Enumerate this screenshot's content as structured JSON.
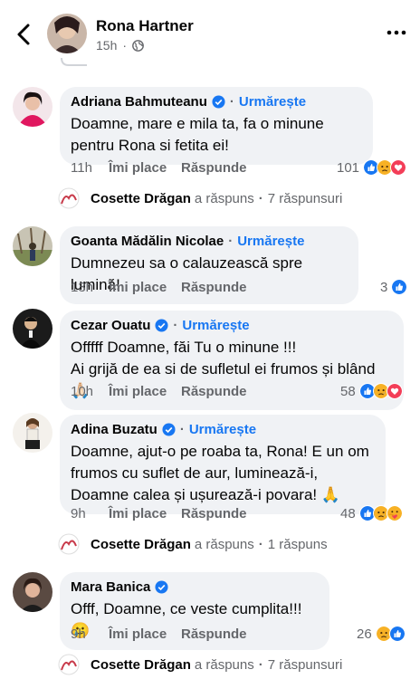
{
  "header": {
    "name": "Rona Hartner",
    "time": "15h",
    "globe_icon": "globe-icon"
  },
  "comments": [
    {
      "author": "Adriana Bahmuteanu",
      "verified": true,
      "follow": "Urmărește",
      "text": "Doamne, mare e mila ta, fa o minune pentru Rona si fetita ei!",
      "time": "11h",
      "like": "Îmi place",
      "reply": "Răspunde",
      "reaction_count": "101",
      "reactions": [
        "like",
        "sad",
        "love"
      ],
      "reply_summary": {
        "name": "Cosette Drăgan",
        "action": "a răspuns",
        "count": "7 răspunsuri"
      }
    },
    {
      "author": "Goanta Mădălin Nicolae",
      "verified": false,
      "follow": "Urmărește",
      "text": "Dumnezeu sa o calauzească spre lumină!",
      "time": "13h",
      "like": "Îmi place",
      "reply": "Răspunde",
      "reaction_count": "3",
      "reactions": [
        "like"
      ]
    },
    {
      "author": "Cezar Ouatu",
      "verified": true,
      "follow": "Urmărește",
      "text": "Offfff Doamne, făi Tu o minune !!!\nAi grijă de ea si de sufletul ei frumos și blând 🙏🏻",
      "time": "10h",
      "like": "Îmi place",
      "reply": "Răspunde",
      "reaction_count": "58",
      "reactions": [
        "like",
        "sad",
        "love"
      ]
    },
    {
      "author": "Adina Buzatu",
      "verified": true,
      "follow": "Urmărește",
      "text": "Doamne, ajut-o pe roaba ta, Rona! E un om frumos cu suflet de aur, luminează-i, Doamne calea și ușurează-i povara! 🙏",
      "time": "9h",
      "like": "Îmi place",
      "reply": "Răspunde",
      "reaction_count": "48",
      "reactions": [
        "like",
        "sad",
        "care"
      ],
      "reply_summary": {
        "name": "Cosette Drăgan",
        "action": "a răspuns",
        "count": "1 răspuns"
      }
    },
    {
      "author": "Mara Banica",
      "verified": true,
      "follow": "",
      "text": "Offf, Doamne, ce veste cumplita!!!🥲",
      "time": "9h",
      "like": "Îmi place",
      "reply": "Răspunde",
      "reaction_count": "26",
      "reactions": [
        "sad",
        "like"
      ],
      "reply_summary": {
        "name": "Cosette Drăgan",
        "action": "a răspuns",
        "count": "7 răspunsuri"
      }
    }
  ],
  "colors": {
    "accent": "#1877f2",
    "bubble": "#f0f2f5",
    "muted": "#65676b",
    "like": "#1877f2",
    "love": "#f33e58",
    "sad": "#f7b125"
  }
}
